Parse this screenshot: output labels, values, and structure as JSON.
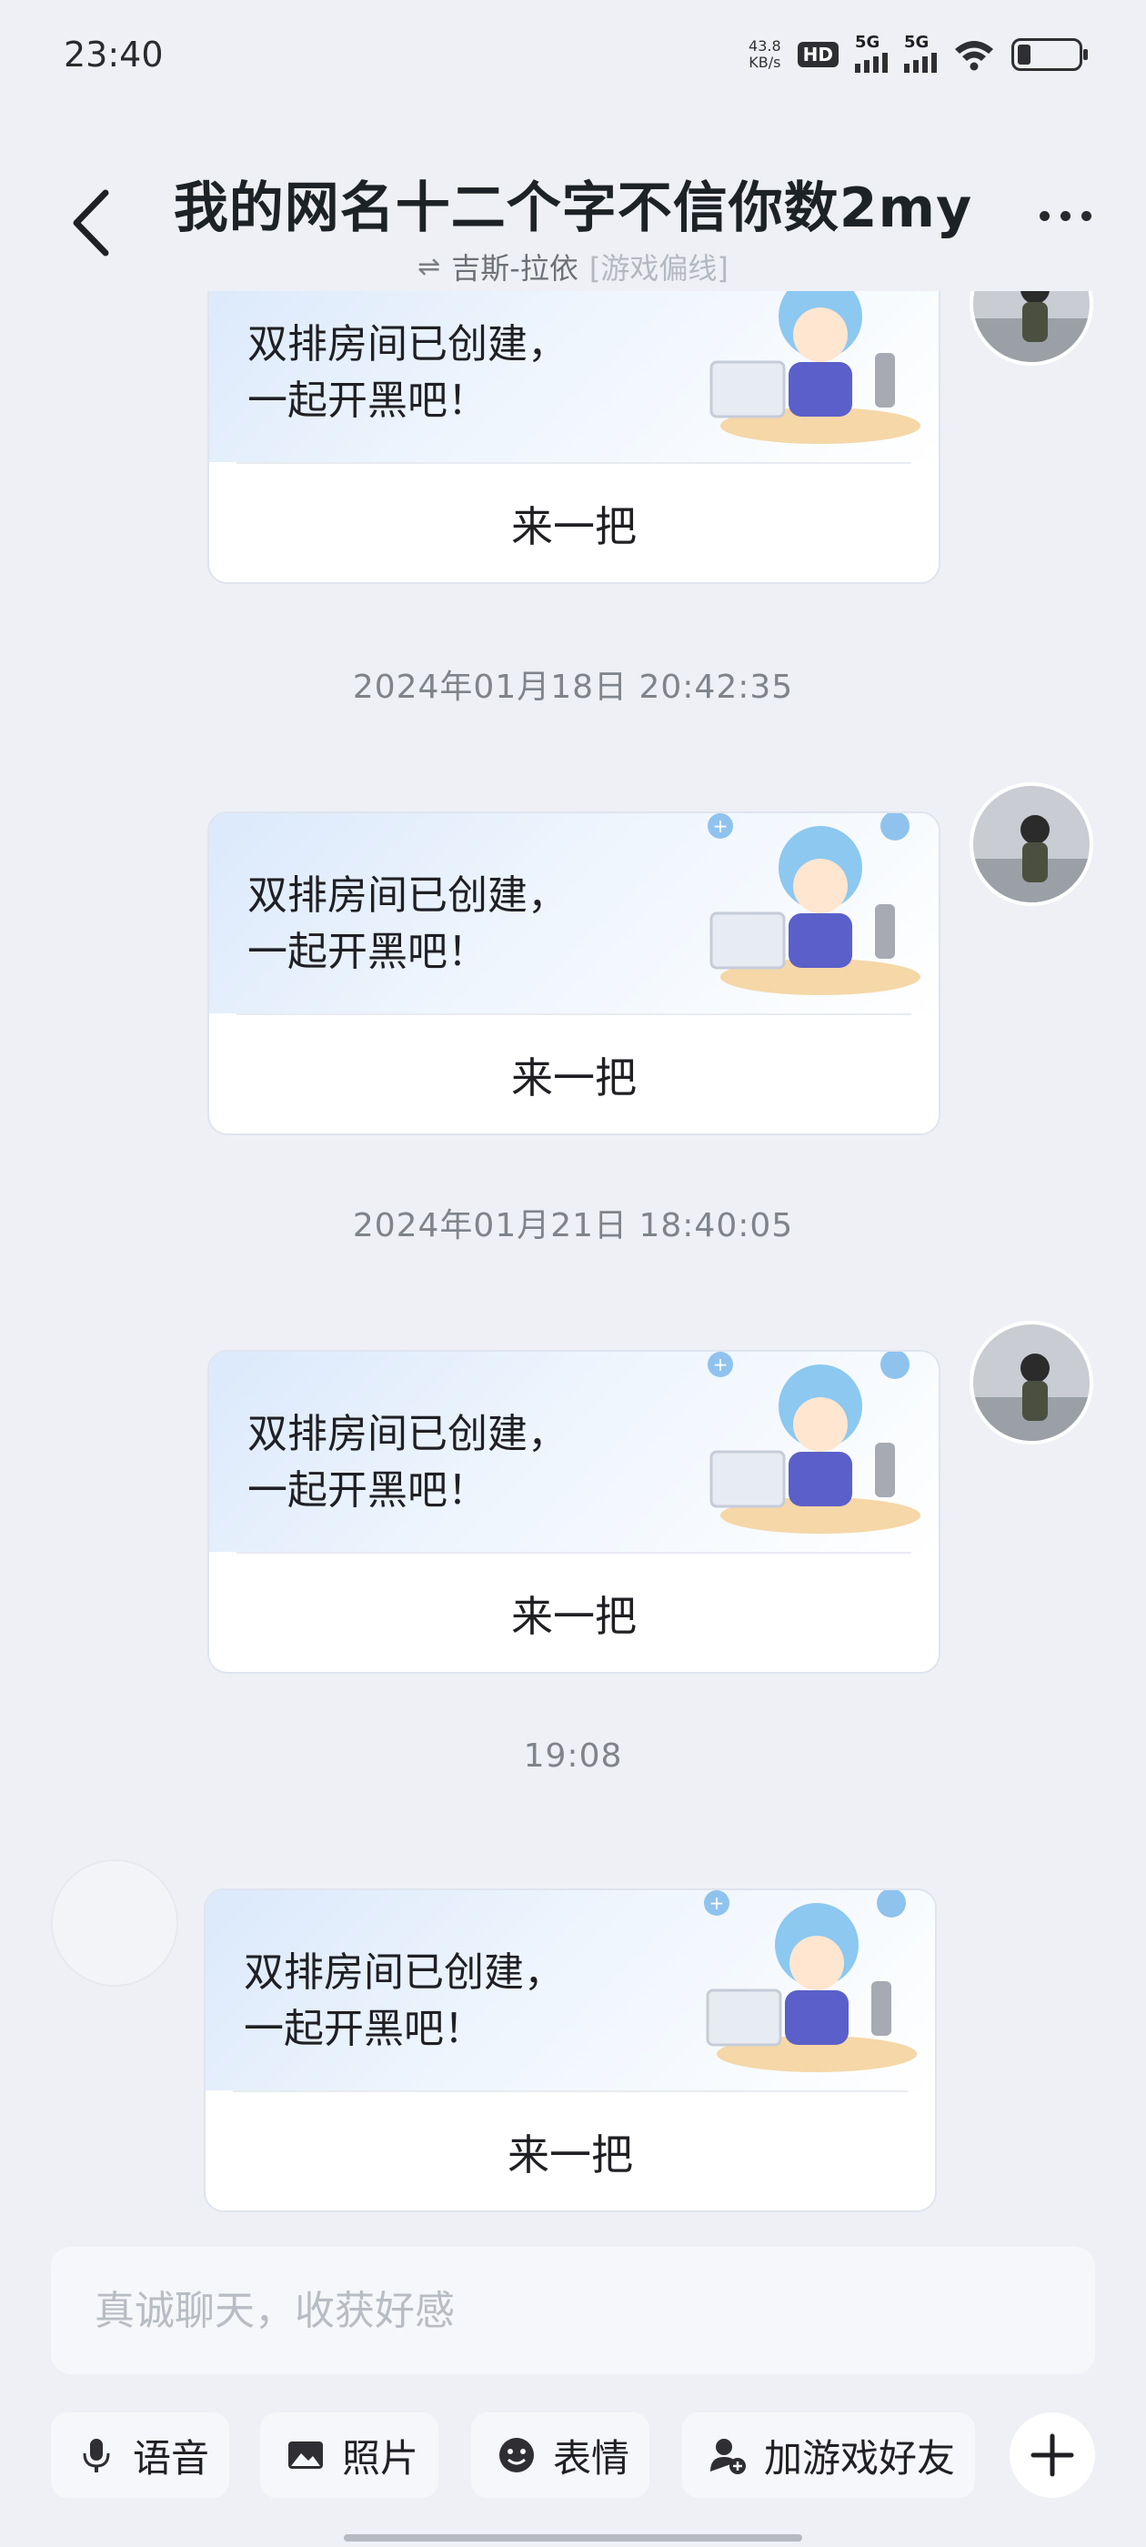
{
  "status_bar": {
    "time": "23:40",
    "net_speed_value": "43.8",
    "net_speed_unit": "KB/s",
    "hd_label": "HD",
    "signal1_label": "5G",
    "signal2_label": "5G",
    "battery_level": 0.2
  },
  "header": {
    "title": "我的网名十二个字不信你数2my",
    "subtitle_game": "吉斯-拉依",
    "subtitle_tag": "[游戏偏线]",
    "back_icon": "back-chevron-icon",
    "more_icon": "more-dots-icon"
  },
  "messages": [
    {
      "card_text_line1": "双排房间已创建，",
      "card_text_line2": "一起开黑吧！",
      "action_label": "来一把"
    },
    {
      "timestamp": "2024年01月18日 20:42:35",
      "card_text_line1": "双排房间已创建，",
      "card_text_line2": "一起开黑吧！",
      "action_label": "来一把"
    },
    {
      "timestamp": "2024年01月21日 18:40:05",
      "card_text_line1": "双排房间已创建，",
      "card_text_line2": "一起开黑吧！",
      "action_label": "来一把"
    },
    {
      "timestamp": "19:08",
      "card_text_line1": "双排房间已创建，",
      "card_text_line2": "一起开黑吧！",
      "action_label": "来一把"
    }
  ],
  "input": {
    "placeholder": "真诚聊天，收获好感"
  },
  "toolbar": {
    "voice_label": "语音",
    "photo_label": "照片",
    "emoji_label": "表情",
    "add_friend_label": "加游戏好友"
  },
  "colors": {
    "background": "#eef0f6",
    "card_gradient": "#dbe9fb",
    "text": "#1f1f24",
    "timestamp": "#80838a"
  }
}
